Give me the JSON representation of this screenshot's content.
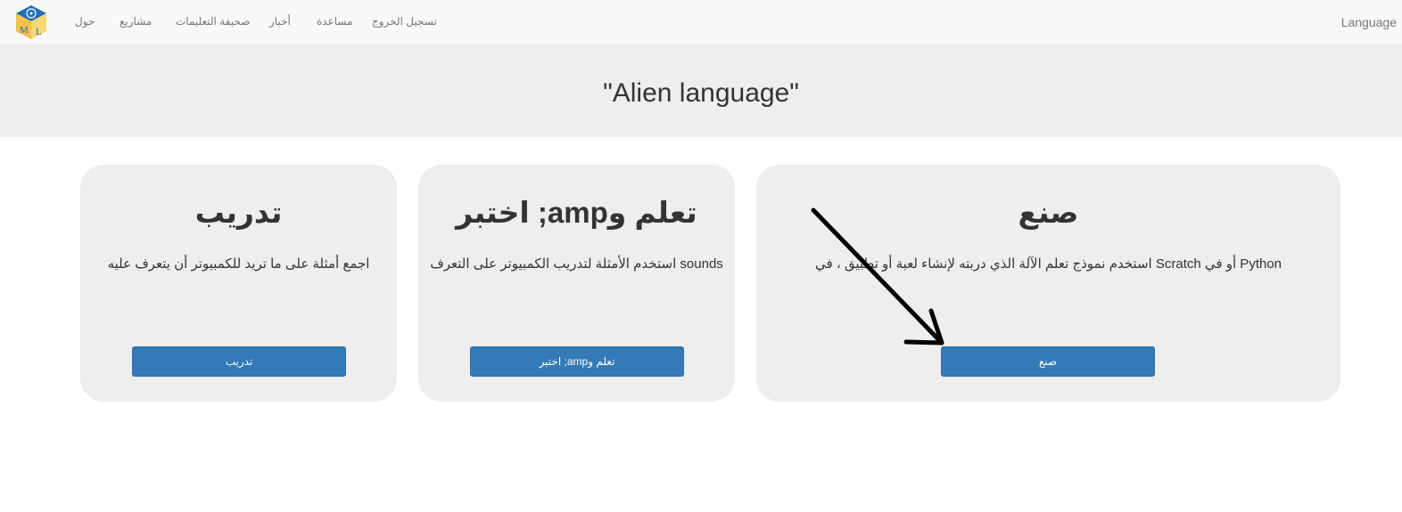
{
  "navbar": {
    "logo_letters": [
      "M",
      "L"
    ],
    "items": [
      "حول",
      "مشاريع",
      "صحيفة التعليمات",
      "أخبار",
      "مساعدة",
      "تسجيل الخروج"
    ],
    "language": "Language"
  },
  "header": {
    "title": "\"Alien language\""
  },
  "cards": {
    "train": {
      "title": "تدريب",
      "description": "اجمع أمثلة على ما تريد للكمبيوتر أن يتعرف عليه",
      "button": "تدريب"
    },
    "test": {
      "title": "اختبر ;amp‪تعلم و",
      "description": "استخدم الأمثلة لتدريب الكمبيوتر على التعرف sounds",
      "button": "اختبر ;amp‪تعلم و"
    },
    "make": {
      "title": "صنع",
      "description": "استخدم نموذج تعلم الآلة الذي دربته لإنشاء لعبة أو تطبيق ، في Scratch أو في Python",
      "button": "صنع"
    }
  },
  "colors": {
    "button": "#337ab7",
    "card": "#eeeeee",
    "navbar": "#f8f8f8"
  },
  "icons": {
    "logo": "ml-cube-logo-icon",
    "annotation": "drawn-arrow-icon"
  }
}
